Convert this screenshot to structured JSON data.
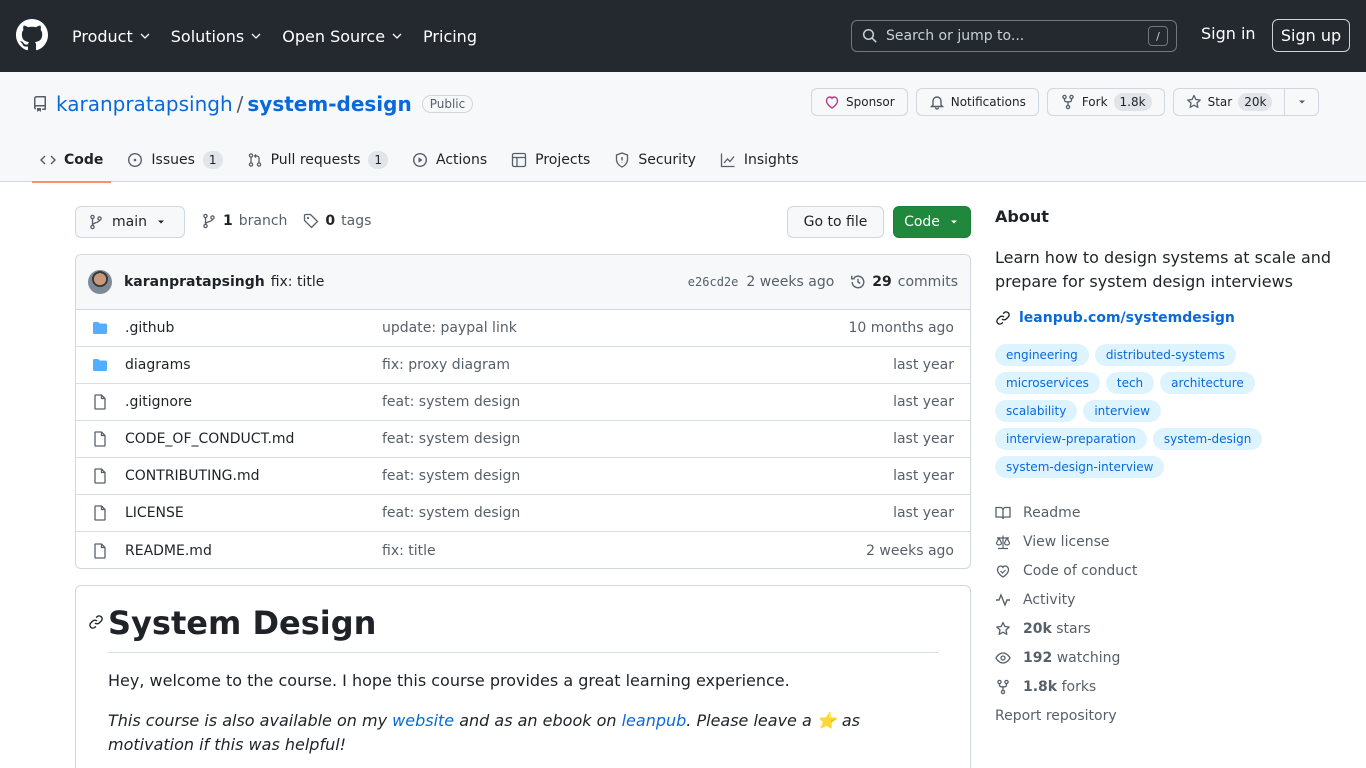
{
  "header": {
    "nav": [
      "Product",
      "Solutions",
      "Open Source",
      "Pricing"
    ],
    "search_placeholder": "Search or jump to...",
    "search_key": "/",
    "signin": "Sign in",
    "signup": "Sign up"
  },
  "repo": {
    "owner": "karanpratapsingh",
    "separator": "/",
    "name": "system-design",
    "visibility": "Public",
    "sponsor": "Sponsor",
    "notifications": "Notifications",
    "fork": "Fork",
    "fork_count": "1.8k",
    "star": "Star",
    "star_count": "20k"
  },
  "tabs": [
    {
      "label": "Code"
    },
    {
      "label": "Issues",
      "count": "1"
    },
    {
      "label": "Pull requests",
      "count": "1"
    },
    {
      "label": "Actions"
    },
    {
      "label": "Projects"
    },
    {
      "label": "Security"
    },
    {
      "label": "Insights"
    }
  ],
  "branch": {
    "current": "main",
    "branch_count": "1",
    "branch_label": "branch",
    "tag_count": "0",
    "tag_label": "tags",
    "goto_file": "Go to file",
    "code_button": "Code"
  },
  "commit": {
    "author": "karanpratapsingh",
    "message": "fix: title",
    "sha": "e26cd2e",
    "time": "2 weeks ago",
    "count": "29",
    "count_label": "commits"
  },
  "files": [
    {
      "type": "dir",
      "name": ".github",
      "message": "update: paypal link",
      "time": "10 months ago"
    },
    {
      "type": "dir",
      "name": "diagrams",
      "message": "fix: proxy diagram",
      "time": "last year"
    },
    {
      "type": "file",
      "name": ".gitignore",
      "message": "feat: system design",
      "time": "last year"
    },
    {
      "type": "file",
      "name": "CODE_OF_CONDUCT.md",
      "message": "feat: system design",
      "time": "last year"
    },
    {
      "type": "file",
      "name": "CONTRIBUTING.md",
      "message": "feat: system design",
      "time": "last year"
    },
    {
      "type": "file",
      "name": "LICENSE",
      "message": "feat: system design",
      "time": "last year"
    },
    {
      "type": "file",
      "name": "README.md",
      "message": "fix: title",
      "time": "2 weeks ago"
    }
  ],
  "readme": {
    "title": "System Design",
    "p1": "Hey, welcome to the course. I hope this course provides a great learning experience.",
    "p2_a": "This course is also available on my ",
    "p2_link1": "website",
    "p2_b": " and as an ebook on ",
    "p2_link2": "leanpub",
    "p2_c": ". Please leave a ⭐ as motivation if this was helpful!"
  },
  "about": {
    "title": "About",
    "description": "Learn how to design systems at scale and prepare for system design interviews",
    "website": "leanpub.com/systemdesign",
    "topics": [
      "engineering",
      "distributed-systems",
      "microservices",
      "tech",
      "architecture",
      "scalability",
      "interview",
      "interview-preparation",
      "system-design",
      "system-design-interview"
    ],
    "readme": "Readme",
    "license": "View license",
    "conduct": "Code of conduct",
    "activity": "Activity",
    "stars_count": "20k",
    "stars_label": "stars",
    "watching_count": "192",
    "watching_label": "watching",
    "forks_count": "1.8k",
    "forks_label": "forks",
    "report": "Report repository"
  }
}
